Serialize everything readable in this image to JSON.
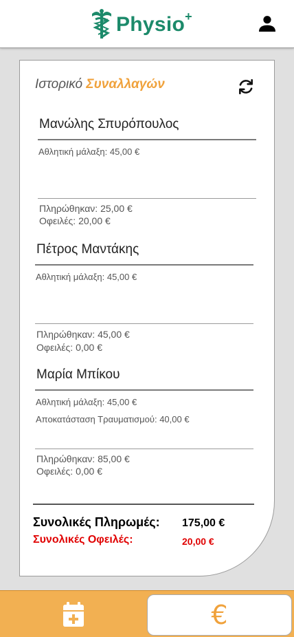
{
  "header": {
    "brand": "Physio",
    "brand_sup": "+"
  },
  "card": {
    "title_plain": "Ιστορικό ",
    "title_accent": "Συναλλαγών"
  },
  "clients": [
    {
      "name": "Μανώλης Σπυρόπουλος",
      "services": [
        "Αθλητική μάλαξη: 45,00 €"
      ],
      "paid": "Πληρώθηκαν: 25,00 €",
      "owed": "Οφειλές: 20,00 €"
    },
    {
      "name": "Πέτρος Μαντάκης",
      "services": [
        "Αθλητική μάλαξη: 45,00 €"
      ],
      "paid": "Πληρώθηκαν: 45,00 €",
      "owed": "Οφειλές: 0,00 €"
    },
    {
      "name": "Μαρία Μπίκου",
      "services": [
        "Αθλητική μάλαξη: 45,00 €",
        "Αποκατάσταση Τραυματισμού: 40,00 €"
      ],
      "paid": "Πληρώθηκαν: 85,00 €",
      "owed": "Οφειλές: 0,00 €"
    }
  ],
  "totals": {
    "payments_label": "Συνολικές Πληρωμές:",
    "payments_value": "175,00 €",
    "debts_label": "Συνολικές Οφειλές:",
    "debts_value": "20,00 €"
  },
  "bottom_nav": {
    "payments_symbol": "€"
  },
  "colors": {
    "brand_green": "#1c8a6a",
    "accent_orange": "#f0a23c",
    "debt_red": "#e00000"
  },
  "icons": {
    "logo": "caduceus-icon",
    "user": "user-icon",
    "refresh": "refresh-icon",
    "calendar": "calendar-add-icon",
    "payments": "euro-icon"
  }
}
